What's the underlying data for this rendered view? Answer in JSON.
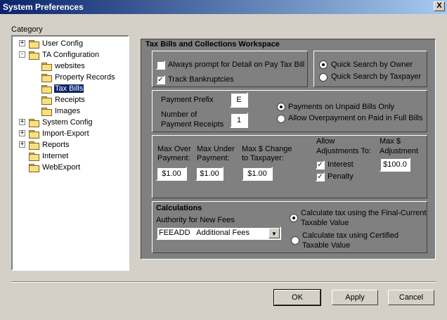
{
  "window": {
    "title": "System Preferences",
    "close_label": "X"
  },
  "category": {
    "label": "Category",
    "items": [
      {
        "label": "User Config",
        "expander": "+"
      },
      {
        "label": "TA Configuration",
        "expander": "-"
      },
      {
        "label": "websites"
      },
      {
        "label": "Property Records"
      },
      {
        "label": "Tax Bills"
      },
      {
        "label": "Receipts"
      },
      {
        "label": "Images"
      },
      {
        "label": "System Config",
        "expander": "+"
      },
      {
        "label": "Import-Export",
        "expander": "+"
      },
      {
        "label": "Reports",
        "expander": "+"
      },
      {
        "label": "Internet"
      },
      {
        "label": "WebExport"
      }
    ]
  },
  "workspace": {
    "title": "Tax Bills and Collections Workspace",
    "always_prompt_label": "Always prompt for Detail on Pay Tax Bill",
    "always_prompt_checked": false,
    "track_bankruptcies_label": "Track Bankruptcies",
    "track_bankruptcies_checked": true,
    "quick_search_owner": "Quick Search by Owner",
    "quick_search_taxpayer": "Quick Search by Taxpayer",
    "quick_search_selected": "owner",
    "payment_prefix_label": "Payment Prefix",
    "payment_prefix_value": "E",
    "num_receipts_label_1": "Number of",
    "num_receipts_label_2": "Payment Receipts",
    "num_receipts_value": "1",
    "payments_unpaid_label": "Payments on Unpaid Bills Only",
    "allow_overpayment_label": "Allow Overpayment on Paid in Full Bills",
    "payment_option_selected": "unpaid",
    "max_over_label_1": "Max Over",
    "max_over_label_2": "Payment:",
    "max_over_value": "$1.00",
    "max_under_label_1": "Max Under",
    "max_under_label_2": "Payment:",
    "max_under_value": "$1.00",
    "max_change_label_1": "Max $ Change",
    "max_change_label_2": "to Taxpayer:",
    "max_change_value": "$1.00",
    "allow_adj_label_1": "Allow",
    "allow_adj_label_2": "Adjustments To:",
    "interest_label": "Interest",
    "interest_checked": true,
    "penalty_label": "Penalty",
    "penalty_checked": true,
    "max_adj_label_1": "Max $",
    "max_adj_label_2": "Adjustment",
    "max_adj_value": "$100.0",
    "calculations_title": "Calculations",
    "authority_label": "Authority for New Fees",
    "authority_value": "FEEADD   Additional Fees",
    "calc_final_1": "Calculate tax using the Final-Current",
    "calc_final_2": "Taxable Value",
    "calc_certified_1": "Calculate tax using Certified",
    "calc_certified_2": "Taxable Value",
    "calc_selected": "final"
  },
  "buttons": {
    "ok": "OK",
    "apply": "Apply",
    "cancel": "Cancel"
  },
  "colors": {
    "title_start": "#0a246a",
    "title_end": "#a6caf0",
    "panel": "#808080",
    "face": "#d4d0c8",
    "selection": "#0a246a"
  }
}
